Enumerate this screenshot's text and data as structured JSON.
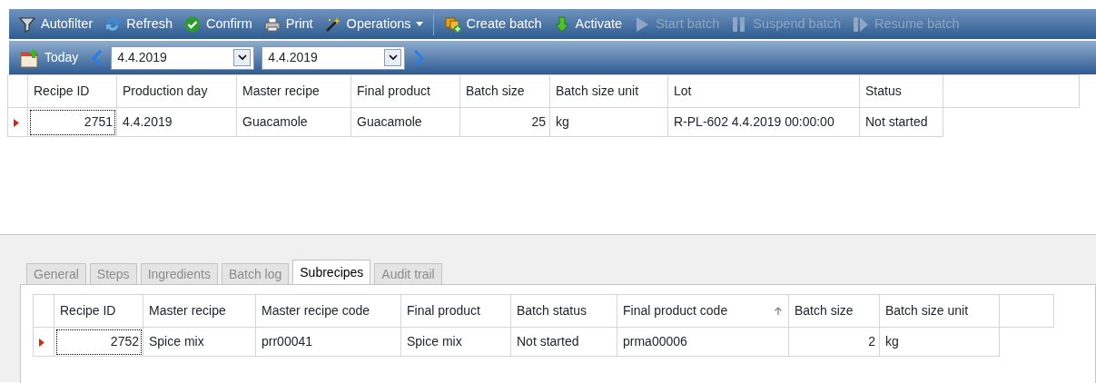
{
  "toolbar": [
    {
      "kind": "button",
      "label": "Autofilter",
      "disabled": false
    },
    {
      "kind": "button",
      "label": "Refresh",
      "disabled": false
    },
    {
      "kind": "button",
      "label": "Confirm",
      "disabled": false
    },
    {
      "kind": "button",
      "label": "Print",
      "disabled": false
    },
    {
      "kind": "dropdown",
      "label": "Operations",
      "disabled": false
    },
    {
      "kind": "separator"
    },
    {
      "kind": "button",
      "label": "Create batch",
      "disabled": false
    },
    {
      "kind": "button",
      "label": "Activate",
      "disabled": false
    },
    {
      "kind": "button",
      "label": "Start batch",
      "disabled": true
    },
    {
      "kind": "button",
      "label": "Suspend batch",
      "disabled": true
    },
    {
      "kind": "button",
      "label": "Resume batch",
      "disabled": true
    }
  ],
  "datebar": {
    "today": "Today",
    "from": "4.4.2019",
    "to": "4.4.2019"
  },
  "grid": {
    "columns": [
      {
        "label": "Recipe ID",
        "numeric": true
      },
      {
        "label": "Production day",
        "numeric": false
      },
      {
        "label": "Master recipe",
        "numeric": false
      },
      {
        "label": "Final product",
        "numeric": false
      },
      {
        "label": "Batch size",
        "numeric": true
      },
      {
        "label": "Batch size unit",
        "numeric": false
      },
      {
        "label": "Lot",
        "numeric": false
      },
      {
        "label": "Status",
        "numeric": false
      }
    ],
    "rows": [
      {
        "selected": true,
        "cells": [
          "2751",
          "4.4.2019",
          "Guacamole",
          "Guacamole",
          "25",
          "kg",
          "R-PL-602 4.4.2019 00:00:00",
          "Not started"
        ]
      }
    ]
  },
  "tabs": [
    {
      "label": "General",
      "selected": false
    },
    {
      "label": "Steps",
      "selected": false
    },
    {
      "label": "Ingredients",
      "selected": false
    },
    {
      "label": "Batch log",
      "selected": false
    },
    {
      "label": "Subrecipes",
      "selected": true
    },
    {
      "label": "Audit trail",
      "selected": false
    }
  ],
  "subgrid": {
    "columns": [
      {
        "label": "Recipe ID",
        "numeric": true,
        "sorted": false
      },
      {
        "label": "Master recipe",
        "numeric": false,
        "sorted": false
      },
      {
        "label": "Master recipe code",
        "numeric": false,
        "sorted": false
      },
      {
        "label": "Final product",
        "numeric": false,
        "sorted": false
      },
      {
        "label": "Batch status",
        "numeric": false,
        "sorted": false
      },
      {
        "label": "Final product code",
        "numeric": false,
        "sorted": true
      },
      {
        "label": "Batch size",
        "numeric": true,
        "sorted": false
      },
      {
        "label": "Batch size unit",
        "numeric": false,
        "sorted": false
      }
    ],
    "rows": [
      {
        "selected": true,
        "cells": [
          "2752",
          "Spice mix",
          "prr00041",
          "Spice mix",
          "Not started",
          "prma00006",
          "2",
          "kg"
        ]
      }
    ]
  }
}
